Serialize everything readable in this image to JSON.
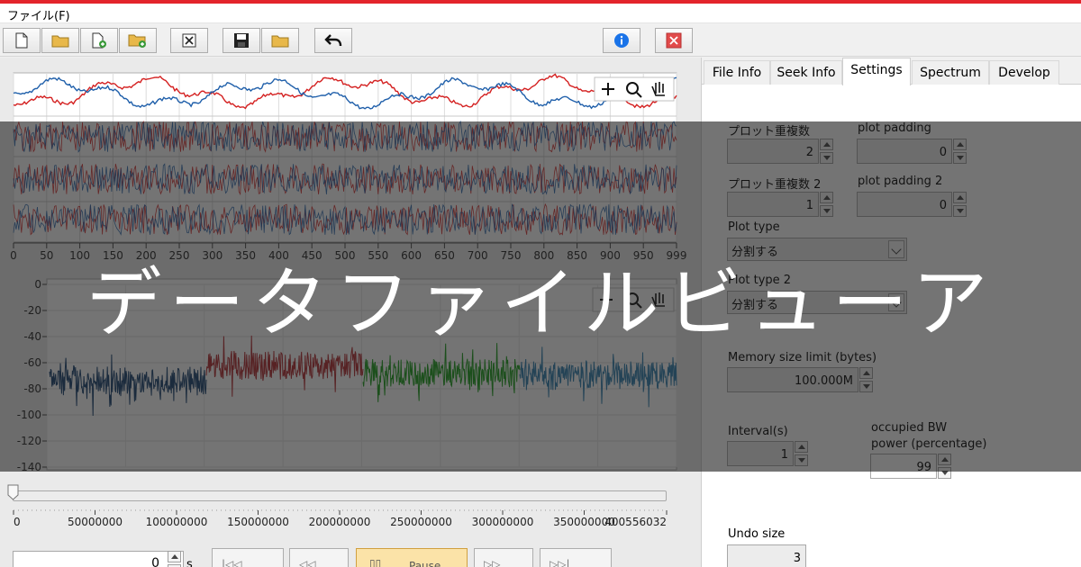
{
  "menu": {
    "file": "ファイル(F)"
  },
  "toolbar": {
    "buttons": [
      {
        "name": "new-file-icon"
      },
      {
        "name": "open-folder-icon"
      },
      {
        "name": "add-file-icon"
      },
      {
        "name": "add-folder-icon"
      },
      {
        "name": "close-box-icon"
      },
      {
        "name": "save-icon"
      },
      {
        "name": "open-folder-2-icon"
      },
      {
        "name": "undo-arrow-icon"
      },
      {
        "name": "info-icon"
      },
      {
        "name": "close-red-icon"
      }
    ]
  },
  "tabs": [
    {
      "label": "File Info",
      "active": false
    },
    {
      "label": "Seek Info",
      "active": false
    },
    {
      "label": "Settings",
      "active": true
    },
    {
      "label": "Spectrum",
      "active": false
    },
    {
      "label": "Develop",
      "active": false
    }
  ],
  "settings": {
    "plot_dup_label": "プロット重複数",
    "plot_dup_value": "2",
    "plot_padding_label": "plot padding",
    "plot_padding_value": "0",
    "plot_dup2_label": "プロット重複数 2",
    "plot_dup2_value": "1",
    "plot_padding2_label": "plot padding 2",
    "plot_padding2_value": "0",
    "plot_type_label": "Plot type",
    "plot_type_value": "分割する",
    "plot_type2_label": "Plot type 2",
    "plot_type2_value": "分割する",
    "memory_label": "Memory size limit (bytes)",
    "memory_value": "100.000M",
    "interval_label": "Interval(s)",
    "interval_value": "1",
    "obw_label_1": "occupied BW",
    "obw_label_2": "power (percentage)",
    "obw_value": "99",
    "undo_label": "Undo size",
    "undo_value": "3"
  },
  "waveform_chart": {
    "x_ticks": [
      "0",
      "50",
      "100",
      "150",
      "200",
      "250",
      "300",
      "350",
      "400",
      "450",
      "500",
      "550",
      "600",
      "650",
      "700",
      "750",
      "800",
      "850",
      "900",
      "950",
      "999"
    ],
    "series_colors": [
      "#1f5faa",
      "#d42020"
    ]
  },
  "spectrum_chart": {
    "y_ticks": [
      "0",
      "-20",
      "-40",
      "-60",
      "-80",
      "-100",
      "-120",
      "-140"
    ],
    "segment_colors": [
      "#163f6e",
      "#b2292d",
      "#1a9e1a",
      "#2f7fb0"
    ]
  },
  "timeline": {
    "ticks": [
      "0",
      "50000000",
      "100000000",
      "150000000",
      "200000000",
      "250000000",
      "300000000",
      "350000000",
      "400556032"
    ]
  },
  "playback": {
    "time_value": "0",
    "time_unit": "s",
    "pause_label": "Pause"
  },
  "overlay_title": "データファイルビューア",
  "chart_data": [
    {
      "type": "line",
      "title": "",
      "xlabel": "",
      "ylabel": "",
      "xlim": [
        0,
        999
      ],
      "x_ticks": [
        0,
        50,
        100,
        150,
        200,
        250,
        300,
        350,
        400,
        450,
        500,
        550,
        600,
        650,
        700,
        750,
        800,
        850,
        900,
        950,
        999
      ],
      "series": [
        {
          "color": "#1f5faa"
        },
        {
          "color": "#d42020"
        }
      ]
    },
    {
      "type": "line",
      "title": "",
      "xlabel": "",
      "ylabel": "",
      "ylim": [
        -140,
        0
      ],
      "y_ticks": [
        0,
        -20,
        -40,
        -60,
        -80,
        -100,
        -120,
        -140
      ],
      "segments": [
        {
          "color": "#163f6e",
          "baseline": -74
        },
        {
          "color": "#b2292d",
          "baseline": -62
        },
        {
          "color": "#1a9e1a",
          "baseline": -68
        },
        {
          "color": "#2f7fb0",
          "baseline": -70
        }
      ]
    }
  ]
}
